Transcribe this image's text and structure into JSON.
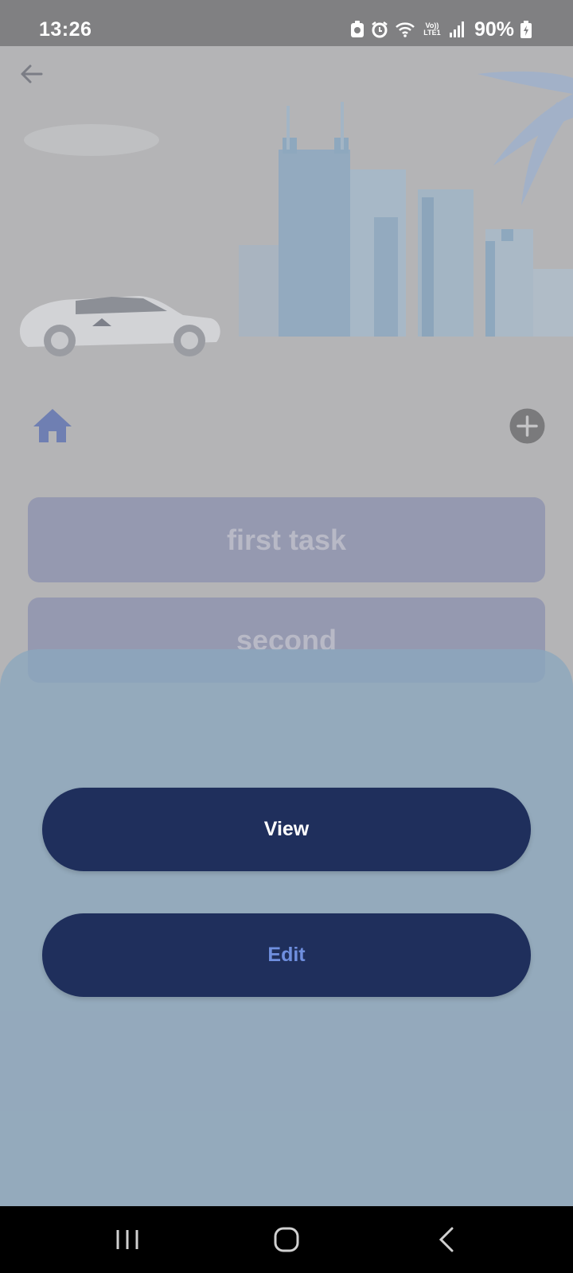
{
  "status_bar": {
    "time": "13:26",
    "signal_label": "Vo)) LTE1",
    "battery": "90%",
    "icons": [
      "app-notification-icon",
      "alarm-icon",
      "wifi-icon",
      "volte-icon",
      "signal-icon",
      "battery-charging-icon"
    ]
  },
  "header": {
    "back_icon": "back-arrow-icon"
  },
  "toolbar": {
    "home_icon": "home-icon",
    "add_icon": "add-circle-icon"
  },
  "tasks": [
    {
      "title": "first task"
    },
    {
      "title": "second"
    }
  ],
  "sheet": {
    "view_label": "View",
    "edit_label": "Edit"
  },
  "nav": {
    "icons": [
      "recents-icon",
      "home-button-icon",
      "back-icon"
    ]
  },
  "colors": {
    "sheet_button_bg": "#1f2f5c",
    "view_text": "#ffffff",
    "edit_text": "#6f8fdf",
    "task_card_bg": "#9599b0"
  }
}
